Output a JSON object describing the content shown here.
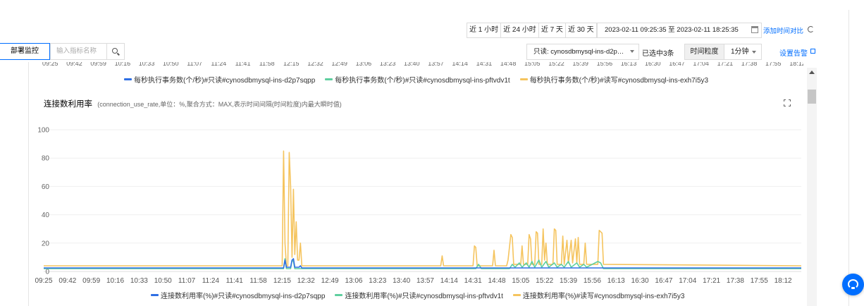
{
  "time_range": {
    "buttons": [
      "近 1 小时",
      "近 24 小时",
      "近 7 天",
      "近 30 天"
    ],
    "date_range": "2023-02-11 09:25:35 至 2023-02-11 18:25:35",
    "add_compare": "添加时间对比"
  },
  "toolbar": {
    "tab_deploy": "部署监控",
    "search_placeholder": "输入指标名称",
    "instance_select": "只读: cynosdbmysql-ins-d2p…",
    "selected_count": "已选中3条",
    "granularity_label": "时间粒度",
    "granularity_value": "1分钟",
    "set_alarm": "设置告警"
  },
  "previous_chart": {
    "axis_labels": [
      "09:25",
      "09:42",
      "09:59",
      "10:16",
      "10:33",
      "10:50",
      "11:07",
      "11:24",
      "11:41",
      "11:58",
      "12:15",
      "12:32",
      "12:49",
      "13:06",
      "13:23",
      "13:40",
      "13:57",
      "14:14",
      "14:31",
      "14:48",
      "15:05",
      "15:22",
      "15:39",
      "15:56",
      "16:13",
      "16:30",
      "16:47",
      "17:04",
      "17:21",
      "17:38",
      "17:55",
      "18:12"
    ],
    "legend": [
      {
        "name": "每秒执行事务数(个/秒)#只读#cynosdbmysql-ins-d2p7sqpp",
        "color": "#2f6fe4"
      },
      {
        "name": "每秒执行事务数(个/秒)#只读#cynosdbmysql-ins-pftvdv1t",
        "color": "#5fcf9f"
      },
      {
        "name": "每秒执行事务数(个/秒)#读写#cynosdbmysql-ins-exh7i5y3",
        "color": "#f5c45e"
      }
    ]
  },
  "chart": {
    "title": "连接数利用率",
    "subtitle": "(connection_use_rate,单位：%,聚合方式：MAX,表示时间间隔(时间粒度)内最大瞬时值)"
  },
  "chart_data": {
    "type": "line",
    "title": "连接数利用率",
    "subtitle": "(connection_use_rate,单位：%,聚合方式：MAX,表示时间间隔(时间粒度)内最大瞬时值)",
    "xlabel": "",
    "ylabel": "",
    "ylim": [
      0,
      100
    ],
    "yticks": [
      0,
      20,
      40,
      60,
      80,
      100
    ],
    "xlim": [
      "09:25",
      "18:25"
    ],
    "xticks": [
      "09:25",
      "09:42",
      "09:59",
      "10:16",
      "10:33",
      "10:50",
      "11:07",
      "11:24",
      "11:41",
      "11:58",
      "12:15",
      "12:32",
      "12:49",
      "13:06",
      "13:23",
      "13:40",
      "13:57",
      "14:14",
      "14:31",
      "14:48",
      "15:05",
      "15:22",
      "15:39",
      "15:56",
      "16:13",
      "16:30",
      "16:47",
      "17:04",
      "17:21",
      "17:38",
      "17:55",
      "18:12"
    ],
    "grid": "horizontal",
    "legend_position": "bottom",
    "series": [
      {
        "name": "连接数利用率(%)#只读#cynosdbmysql-ins-d2p7sqpp",
        "color": "#2f6fe4",
        "points": [
          [
            "09:25",
            2.5
          ],
          [
            "12:16",
            2.5
          ],
          [
            "12:17",
            8
          ],
          [
            "12:18",
            3
          ],
          [
            "12:21",
            3
          ],
          [
            "12:22",
            8
          ],
          [
            "12:23",
            9
          ],
          [
            "12:24",
            3
          ],
          [
            "12:27",
            3
          ],
          [
            "12:28",
            4
          ],
          [
            "12:29",
            2.5
          ],
          [
            "18:25",
            2.5
          ]
        ]
      },
      {
        "name": "连接数利用率(%)#只读#cynosdbmysql-ins-pftvdv1t",
        "color": "#5fcf9f",
        "points": [
          [
            "09:25",
            2
          ],
          [
            "12:16",
            2
          ],
          [
            "12:17",
            9
          ],
          [
            "12:18",
            2
          ],
          [
            "12:21",
            2
          ],
          [
            "12:22",
            8
          ],
          [
            "12:23",
            7
          ],
          [
            "12:24",
            2
          ],
          [
            "14:33",
            2
          ],
          [
            "14:35",
            5
          ],
          [
            "14:37",
            2
          ],
          [
            "14:57",
            2
          ],
          [
            "14:59",
            5
          ],
          [
            "15:01",
            3
          ],
          [
            "15:04",
            6
          ],
          [
            "15:06",
            3
          ],
          [
            "15:09",
            6
          ],
          [
            "15:11",
            3
          ],
          [
            "15:13",
            7
          ],
          [
            "15:15",
            3
          ],
          [
            "15:18",
            8
          ],
          [
            "15:20",
            3
          ],
          [
            "15:23",
            7
          ],
          [
            "15:25",
            3
          ],
          [
            "15:29",
            6
          ],
          [
            "15:31",
            3
          ],
          [
            "15:34",
            5
          ],
          [
            "15:36",
            3
          ],
          [
            "15:39",
            7
          ],
          [
            "15:41",
            3
          ],
          [
            "15:45",
            6
          ],
          [
            "15:47",
            3
          ],
          [
            "15:50",
            5
          ],
          [
            "15:52",
            3
          ],
          [
            "16:00",
            7
          ],
          [
            "16:02",
            6
          ],
          [
            "16:04",
            2
          ],
          [
            "18:25",
            2
          ]
        ]
      },
      {
        "name": "连接数利用率(%)#读写#cynosdbmysql-ins-exh7i5y3",
        "color": "#f5c45e",
        "points": [
          [
            "09:25",
            4
          ],
          [
            "12:15",
            4
          ],
          [
            "12:16",
            85
          ],
          [
            "12:17",
            20
          ],
          [
            "12:18",
            4
          ],
          [
            "12:19",
            4
          ],
          [
            "12:20",
            84
          ],
          [
            "12:21",
            60
          ],
          [
            "12:22",
            10
          ],
          [
            "12:23",
            58
          ],
          [
            "12:24",
            12
          ],
          [
            "12:25",
            35
          ],
          [
            "12:26",
            8
          ],
          [
            "12:27",
            8
          ],
          [
            "12:28",
            20
          ],
          [
            "12:29",
            4
          ],
          [
            "14:08",
            4
          ],
          [
            "14:09",
            11
          ],
          [
            "14:10",
            4
          ],
          [
            "14:31",
            4
          ],
          [
            "14:32",
            18
          ],
          [
            "14:33",
            17
          ],
          [
            "14:34",
            4
          ],
          [
            "14:45",
            4
          ],
          [
            "14:46",
            15
          ],
          [
            "14:47",
            4
          ],
          [
            "14:55",
            4
          ],
          [
            "14:56",
            8
          ],
          [
            "14:58",
            26
          ],
          [
            "14:59",
            24
          ],
          [
            "15:00",
            5
          ],
          [
            "15:05",
            5
          ],
          [
            "15:06",
            18
          ],
          [
            "15:07",
            5
          ],
          [
            "15:10",
            5
          ],
          [
            "15:11",
            26
          ],
          [
            "15:12",
            23
          ],
          [
            "15:13",
            5
          ],
          [
            "15:15",
            5
          ],
          [
            "15:16",
            28
          ],
          [
            "15:17",
            27
          ],
          [
            "15:18",
            5
          ],
          [
            "15:20",
            5
          ],
          [
            "15:21",
            30
          ],
          [
            "15:22",
            8
          ],
          [
            "15:23",
            20
          ],
          [
            "15:24",
            5
          ],
          [
            "15:28",
            5
          ],
          [
            "15:29",
            30
          ],
          [
            "15:30",
            29
          ],
          [
            "15:31",
            5
          ],
          [
            "15:34",
            5
          ],
          [
            "15:35",
            25
          ],
          [
            "15:36",
            5
          ],
          [
            "15:38",
            22
          ],
          [
            "15:39",
            6
          ],
          [
            "15:41",
            22
          ],
          [
            "15:42",
            6
          ],
          [
            "15:44",
            23
          ],
          [
            "15:45",
            6
          ],
          [
            "15:46",
            24
          ],
          [
            "15:47",
            5
          ],
          [
            "15:50",
            5
          ],
          [
            "15:51",
            20
          ],
          [
            "15:52",
            5
          ],
          [
            "16:00",
            5
          ],
          [
            "16:01",
            29
          ],
          [
            "16:02",
            28
          ],
          [
            "16:03",
            27
          ],
          [
            "16:04",
            5
          ],
          [
            "18:25",
            4
          ]
        ]
      }
    ]
  }
}
